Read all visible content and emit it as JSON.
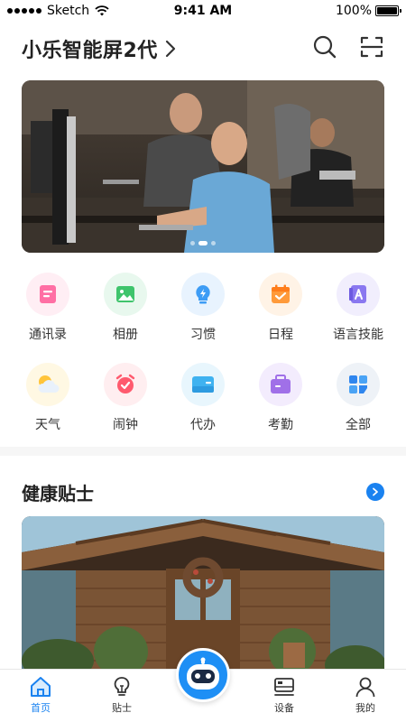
{
  "status_bar": {
    "carrier": "Sketch",
    "time": "9:41 AM",
    "battery": "100%",
    "battery_level": 1.0
  },
  "header": {
    "title": "小乐智能屏2代",
    "title_icon": "chevron-right-icon",
    "actions": [
      "search-icon",
      "scan-icon"
    ]
  },
  "banner": {
    "slide_count": 3,
    "active_slide": 1
  },
  "apps": [
    {
      "label": "通讯录",
      "icon": "contacts-icon",
      "color": "#ff6fa4",
      "bg": "#ffeef4"
    },
    {
      "label": "相册",
      "icon": "album-icon",
      "color": "#3fc46c",
      "bg": "#e8f8ee"
    },
    {
      "label": "习惯",
      "icon": "habit-icon",
      "color": "#3d9cf5",
      "bg": "#e8f3fe"
    },
    {
      "label": "日程",
      "icon": "schedule-icon",
      "color": "#ff9a3a",
      "bg": "#fff3e6"
    },
    {
      "label": "语言技能",
      "icon": "language-icon",
      "color": "#8a78f0",
      "bg": "#f1eefd"
    },
    {
      "label": "天气",
      "icon": "weather-icon",
      "color": "#ffc43a",
      "bg": "#fff8e3"
    },
    {
      "label": "闹钟",
      "icon": "alarm-icon",
      "color": "#ff5a6e",
      "bg": "#ffeef0"
    },
    {
      "label": "代办",
      "icon": "todo-icon",
      "color": "#3fb2f0",
      "bg": "#e8f6fd"
    },
    {
      "label": "考勤",
      "icon": "attendance-icon",
      "color": "#a070e8",
      "bg": "#f3ecfd"
    },
    {
      "label": "全部",
      "icon": "all-apps-icon",
      "color": "#2f86ee",
      "bg": "#eef2f7"
    }
  ],
  "health": {
    "title": "健康贴士",
    "more_icon": "arrow-right-icon"
  },
  "nav": {
    "items": [
      {
        "label": "首页",
        "icon": "home-icon",
        "active": true
      },
      {
        "label": "贴士",
        "icon": "bulb-icon",
        "active": false
      },
      {
        "label": "",
        "icon": "robot-icon",
        "active": false
      },
      {
        "label": "设备",
        "icon": "device-icon",
        "active": false
      },
      {
        "label": "我的",
        "icon": "profile-icon",
        "active": false
      }
    ]
  },
  "colors": {
    "accent": "#1a82f0",
    "title": "#222222",
    "label": "#333333"
  }
}
